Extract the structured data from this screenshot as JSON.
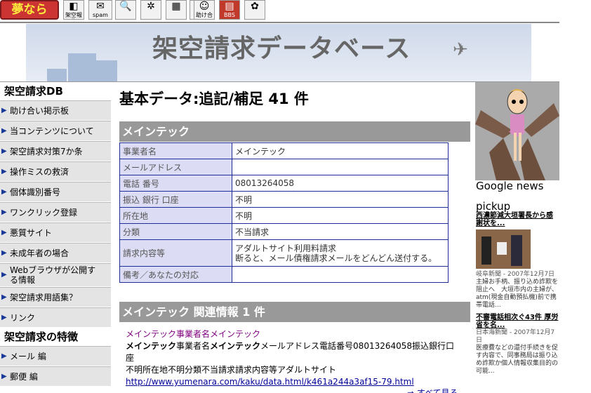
{
  "toolbar": {
    "logo": "夢なら",
    "buttons": [
      {
        "label": "架空報告",
        "icon": "◧"
      },
      {
        "label": "spam",
        "icon": "✉"
      },
      {
        "label": "",
        "icon": "🔍"
      },
      {
        "label": "",
        "icon": "✲"
      },
      {
        "label": "",
        "icon": "▦"
      },
      {
        "label": "",
        "icon": "◆"
      },
      {
        "label": "助け合い",
        "icon": "☺"
      },
      {
        "label": "BBS",
        "icon": "▤"
      },
      {
        "label": "",
        "icon": "✿"
      }
    ]
  },
  "banner": {
    "title": "架空請求データベース",
    "plane_icon": "✈"
  },
  "leftnav": {
    "head1": "架空請求DB",
    "items1": [
      "助け合い掲示板",
      "当コンテンツについて",
      "架空請求対策7か条",
      "操作ミスの救済",
      "個体識別番号",
      "ワンクリック登録",
      "悪質サイト",
      "未成年者の場合",
      "Webブラウザが公開する情報",
      "架空請求用語集？",
      "リンク"
    ],
    "head2": "架空請求の特徴",
    "items2": [
      "メール 編",
      "郵便 編"
    ],
    "arrow_icon": "▶"
  },
  "main": {
    "page_title": "基本データ:追記/補足 41 件",
    "company_bar": "メインテック",
    "rows": [
      {
        "key": "事業者名",
        "value": "メインテック"
      },
      {
        "key": "メールアドレス",
        "value": ""
      },
      {
        "key": "電話 番号",
        "value": "08013264058"
      },
      {
        "key": "振込 銀行 口座",
        "value": "不明"
      },
      {
        "key": "所在地",
        "value": "不明"
      },
      {
        "key": "分類",
        "value": "不当請求"
      },
      {
        "key": "請求内容等",
        "value": "アダルトサイト利用料請求",
        "value2": "断ると、メール債権請求メールをどんどん送付する。"
      },
      {
        "key": "備考／あなたの対応",
        "value": ""
      }
    ],
    "related_bar": "メインテック 関連情報 1 件",
    "related": {
      "link": "メインテック事業者名メインテック",
      "line1_bold1": "メインテック",
      "line1_txt1": "事業者名",
      "line1_bold2": "メインテック",
      "line1_txt2": "メールアドレス電話番号08013264058振込銀行口座",
      "line2": "不明所在地不明分類不当請求請求内容等アダルトサイト",
      "url": "http://www.yumenara.com/kaku/data.html/k461a244a3af15-79.html"
    },
    "see_all": "⇒ すべて見る"
  },
  "rightcol": {
    "gn_title": "Google news",
    "gn_pickup": "pickup",
    "news": [
      {
        "headline": "西濃節減大垣署長から感謝状を...",
        "source": "岐阜新聞 - 2007年12月7日",
        "body": "主婦お手柄、振り込め詐欺を阻止へ　大垣市内の主婦が、atm(現金自動預払機)前で携帯電話..."
      },
      {
        "headline": "不審電話相次ぐ43件 厚労省を名...",
        "source": "日本海新聞 - 2007年12月7日",
        "body": "医療費などの還付手続きを促す内容で、同事務局は振り込め詐欺か個人情報収集目的の可能..."
      }
    ]
  }
}
